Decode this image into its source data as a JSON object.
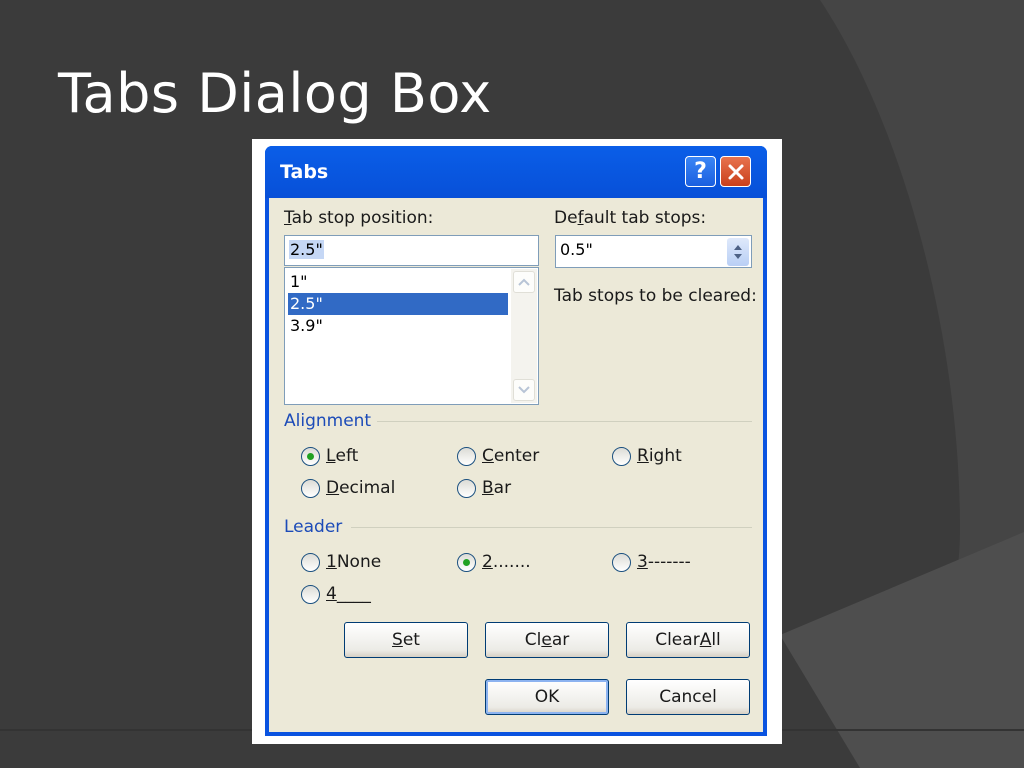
{
  "slide": {
    "title": "Tabs Dialog Box"
  },
  "dialog": {
    "title": "Tabs",
    "help_label": "?",
    "tab_stop_position": {
      "label_pre": "",
      "label_u": "T",
      "label_post": "ab stop position:",
      "value": "2.5\""
    },
    "default_tab_stops": {
      "label_pre": "De",
      "label_u": "f",
      "label_post": "ault tab stops:",
      "value": "0.5\""
    },
    "tab_list": [
      {
        "label": "1\"",
        "selected": false
      },
      {
        "label": "2.5\"",
        "selected": true
      },
      {
        "label": "3.9\"",
        "selected": false
      }
    ],
    "tab_stops_cleared_label": "Tab stops to be cleared:",
    "alignment": {
      "label": "Alignment",
      "options": [
        {
          "u": "L",
          "rest": "eft",
          "checked": true
        },
        {
          "u": "C",
          "rest": "enter",
          "checked": false
        },
        {
          "u": "R",
          "rest": "ight",
          "checked": false
        },
        {
          "u": "D",
          "rest": "ecimal",
          "checked": false
        },
        {
          "u": "B",
          "rest": "ar",
          "checked": false
        }
      ]
    },
    "leader": {
      "label": "Leader",
      "options": [
        {
          "u": "1",
          "rest": " None",
          "checked": false
        },
        {
          "u": "2",
          "rest": " .......",
          "checked": true
        },
        {
          "u": "3",
          "rest": " -------",
          "checked": false
        },
        {
          "u": "4",
          "rest": " ____",
          "checked": false
        }
      ]
    },
    "buttons": {
      "set": {
        "u": "S",
        "rest": "et"
      },
      "clear": {
        "pre": "Cl",
        "u": "e",
        "rest": "ar"
      },
      "clear_all": {
        "pre": "Clear ",
        "u": "A",
        "rest": "ll"
      },
      "ok": "OK",
      "cancel": "Cancel"
    }
  },
  "colors": {
    "titlebar": "#0a5ee8",
    "selection": "#316ac5",
    "group_label": "#1c4bb8"
  }
}
